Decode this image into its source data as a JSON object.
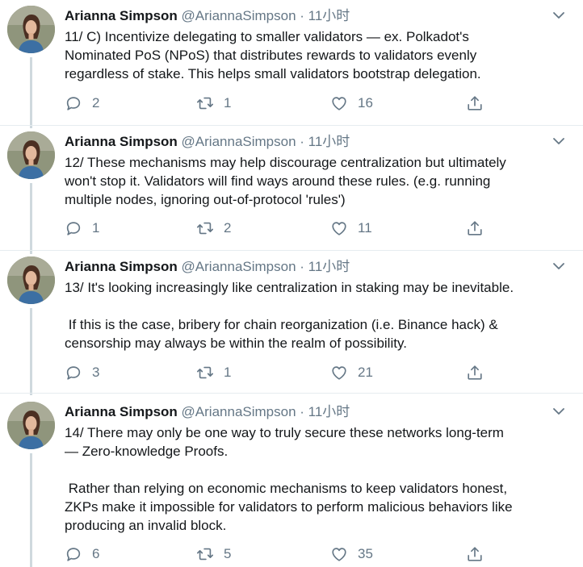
{
  "tweets": [
    {
      "name": "Arianna Simpson",
      "handle": "@AriannaSimpson",
      "time": " · 11小时",
      "text": "11/ C) Incentivize delegating to smaller validators — ex. Polkadot's\nNominated PoS (NPoS) that distributes rewards to validators evenly\nregardless of stake. This helps small validators bootstrap delegation.",
      "replies": "2",
      "retweets": "1",
      "likes": "16"
    },
    {
      "name": "Arianna Simpson",
      "handle": "@AriannaSimpson",
      "time": " · 11小时",
      "text": "12/ These mechanisms may help discourage centralization but ultimately\nwon't stop it. Validators will find ways around these rules. (e.g. running\nmultiple nodes, ignoring out-of-protocol 'rules')",
      "replies": "1",
      "retweets": "2",
      "likes": "11"
    },
    {
      "name": "Arianna Simpson",
      "handle": "@AriannaSimpson",
      "time": " · 11小时",
      "text": "13/ It's looking increasingly like centralization in staking may be inevitable.\n\n If this is the case, bribery for chain reorganization (i.e. Binance hack) &\ncensorship may always be within the realm of possibility.",
      "replies": "3",
      "retweets": "1",
      "likes": "21"
    },
    {
      "name": "Arianna Simpson",
      "handle": "@AriannaSimpson",
      "time": " · 11小时",
      "text": "14/ There may only be one way to truly secure these networks long-term\n— Zero-knowledge Proofs.\n\n Rather than relying on economic mechanisms to keep validators honest,\nZKPs make it impossible for validators to perform malicious behaviors like\nproducing an invalid block.",
      "replies": "6",
      "retweets": "5",
      "likes": "35"
    }
  ],
  "icons": {
    "reply": "reply-icon",
    "retweet": "retweet-icon",
    "like": "heart-icon",
    "share": "share-icon",
    "more": "chevron-down-icon"
  },
  "colors": {
    "text": "#14171a",
    "secondary": "#657786",
    "thread_line": "#cfd9de",
    "divider": "#e6ecf0"
  }
}
